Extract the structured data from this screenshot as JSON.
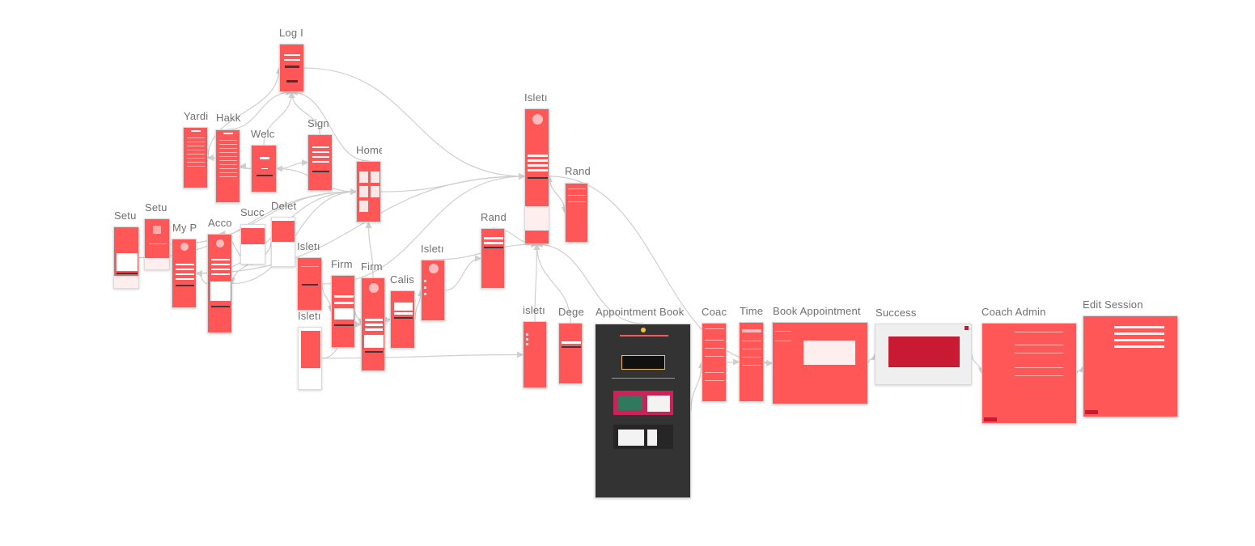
{
  "canvas": {
    "background": "#ffffff",
    "screen_color": "#ff5757",
    "link_color": "#cfcfcf"
  },
  "screens": [
    {
      "id": "login",
      "label": "Log I"
    },
    {
      "id": "yardim",
      "label": "Yardi"
    },
    {
      "id": "hakkinda",
      "label": "Hakk"
    },
    {
      "id": "welcome",
      "label": "Welc"
    },
    {
      "id": "signup",
      "label": "Sign"
    },
    {
      "id": "home",
      "label": "Home"
    },
    {
      "id": "setup1",
      "label": "Setu"
    },
    {
      "id": "setup2",
      "label": "Setu"
    },
    {
      "id": "myprofile",
      "label": "My P"
    },
    {
      "id": "account",
      "label": "Acco"
    },
    {
      "id": "success-small",
      "label": "Succ"
    },
    {
      "id": "delete",
      "label": "Delet"
    },
    {
      "id": "isletme1",
      "label": "Isletı"
    },
    {
      "id": "isletme2",
      "label": "Isletı"
    },
    {
      "id": "firma1",
      "label": "Firm"
    },
    {
      "id": "firma2",
      "label": "Firm"
    },
    {
      "id": "calisan",
      "label": "Calis"
    },
    {
      "id": "isletme3",
      "label": "Isletı"
    },
    {
      "id": "randevu1",
      "label": "Rand"
    },
    {
      "id": "isletme-tall",
      "label": "Isletı"
    },
    {
      "id": "randevu2",
      "label": "Rand"
    },
    {
      "id": "isletme4",
      "label": "isletı"
    },
    {
      "id": "degerlendirme",
      "label": "Dege"
    },
    {
      "id": "appointment-booking",
      "label": "Appointment Book"
    },
    {
      "id": "coach",
      "label": "Coac"
    },
    {
      "id": "time",
      "label": "Time"
    },
    {
      "id": "book-appointment",
      "label": "Book Appointment"
    },
    {
      "id": "success",
      "label": "Success"
    },
    {
      "id": "coach-admin",
      "label": "Coach Admin"
    },
    {
      "id": "edit-session",
      "label": "Edit Session"
    }
  ],
  "links": [
    [
      "welcome",
      "login"
    ],
    [
      "signup",
      "login"
    ],
    [
      "home",
      "login"
    ],
    [
      "hakkinda",
      "login"
    ],
    [
      "yardim",
      "login"
    ],
    [
      "welcome",
      "signup"
    ],
    [
      "welcome",
      "hakkinda"
    ],
    [
      "welcome",
      "yardim"
    ],
    [
      "home",
      "welcome"
    ],
    [
      "myprofile",
      "home"
    ],
    [
      "account",
      "home"
    ],
    [
      "setup2",
      "home"
    ],
    [
      "setup1",
      "home"
    ],
    [
      "home",
      "isletme-tall"
    ],
    [
      "isletme1",
      "isletme-tall"
    ],
    [
      "isletme3",
      "isletme-tall"
    ],
    [
      "randevu1",
      "isletme-tall"
    ],
    [
      "randevu2",
      "isletme-tall"
    ],
    [
      "isletme4",
      "isletme-tall"
    ],
    [
      "account",
      "myprofile"
    ],
    [
      "success-small",
      "account"
    ],
    [
      "delete",
      "account"
    ],
    [
      "isletme1",
      "firma1"
    ],
    [
      "firma1",
      "firma2"
    ],
    [
      "firma2",
      "calisan"
    ],
    [
      "calisan",
      "isletme3"
    ],
    [
      "isletme3",
      "randevu1"
    ],
    [
      "isletme2",
      "isletme4"
    ],
    [
      "degerlendirme",
      "isletme-tall"
    ],
    [
      "appointment-booking",
      "isletme-tall"
    ],
    [
      "appointment-booking",
      "coach"
    ],
    [
      "coach",
      "time"
    ],
    [
      "time",
      "book-appointment"
    ],
    [
      "book-appointment",
      "success"
    ],
    [
      "success",
      "coach-admin"
    ],
    [
      "coach-admin",
      "edit-session"
    ],
    [
      "isletme-tall",
      "randevu2"
    ],
    [
      "login",
      "isletme-tall"
    ],
    [
      "firma2",
      "home"
    ],
    [
      "myprofile",
      "isletme-tall"
    ],
    [
      "isletme-tall",
      "book-appointment"
    ],
    [
      "isletme2",
      "firma2"
    ]
  ]
}
